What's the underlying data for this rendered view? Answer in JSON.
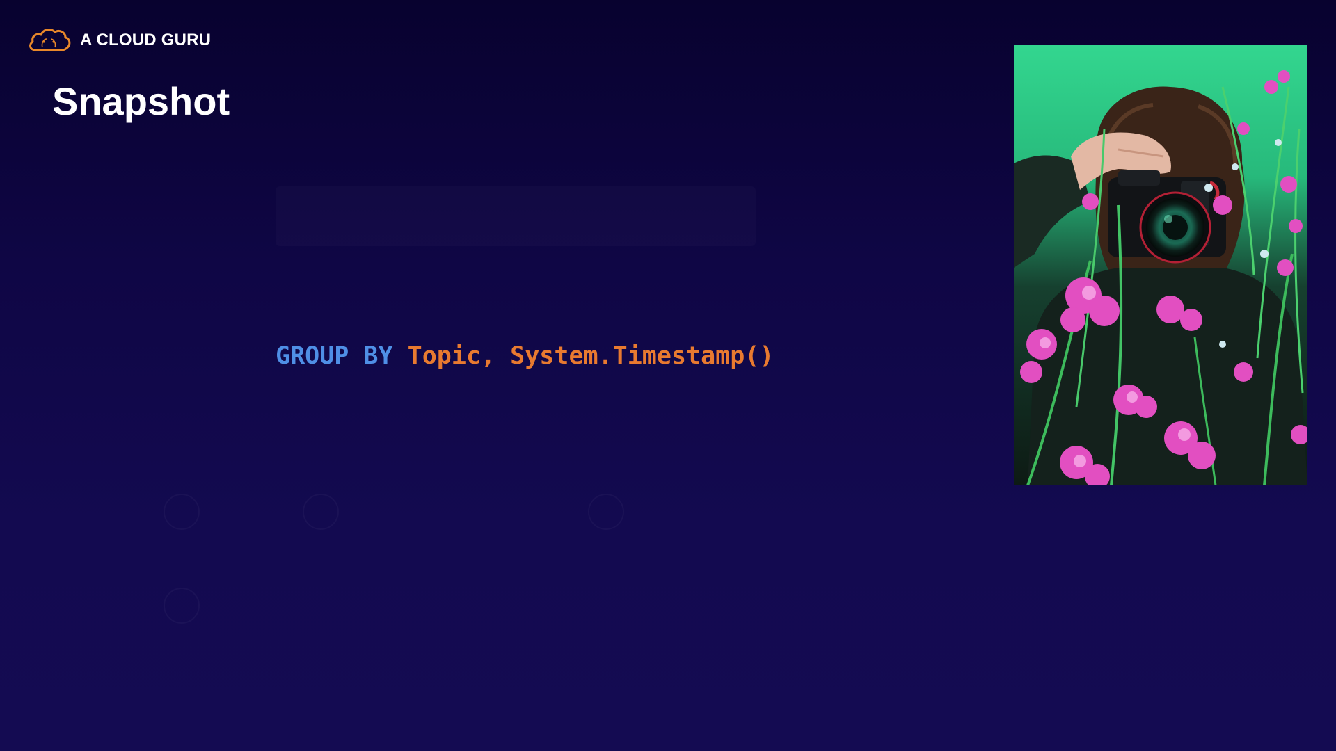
{
  "brand": {
    "icon": "cloud-logo-icon",
    "name": "A CLOUD GURU",
    "accent_color": "#e8882a"
  },
  "slide": {
    "title": "Snapshot"
  },
  "code": {
    "keyword": "GROUP BY",
    "expression": "Topic, System.Timestamp()",
    "keyword_color": "#4f8fe6",
    "expression_color": "#e87a30"
  },
  "photo": {
    "subject": "photographer-with-camera-behind-pink-flowers",
    "background_color": "#2fd38f"
  }
}
